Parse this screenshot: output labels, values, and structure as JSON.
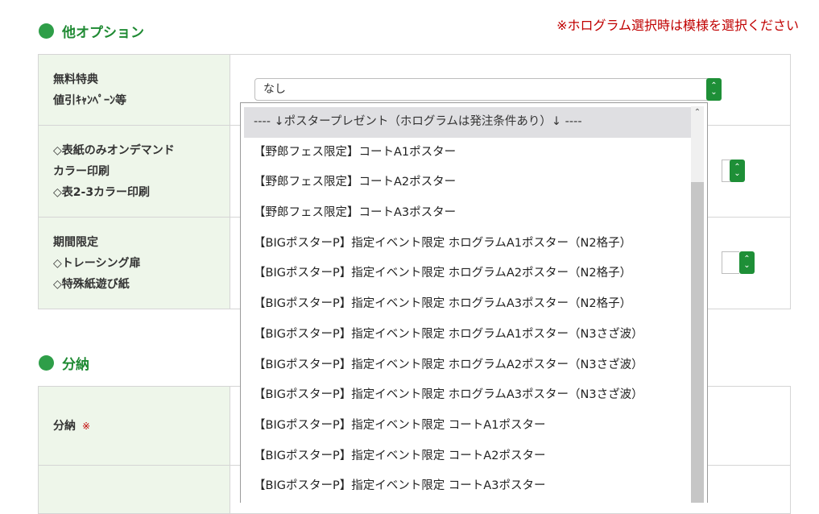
{
  "sections": {
    "other_options": {
      "title": "他オプション"
    },
    "bunno": {
      "title": "分納"
    }
  },
  "notice": "※ホログラム選択時は模様を選択ください",
  "rows": {
    "free_bonus": {
      "line1": "無料特典",
      "line2": "値引ｷｬﾝﾍﾟｰﾝ等"
    },
    "cover": {
      "line1": "◇表紙のみオンデマンド",
      "line2": "カラー印刷",
      "line3": "◇表2-3カラー印刷"
    },
    "limited": {
      "line1": "期間限定",
      "line2": "◇トレーシング扉",
      "line3": "◇特殊紙遊び紙"
    },
    "bunno": {
      "label": "分納",
      "required": "※"
    }
  },
  "select": {
    "value": "なし"
  },
  "dropdown": {
    "options": [
      "---- ↓ポスタープレゼント（ホログラムは発注条件あり）↓ ----",
      "【野郎フェス限定】コートA1ポスター",
      "【野郎フェス限定】コートA2ポスター",
      "【野郎フェス限定】コートA3ポスター",
      "【BIGポスターP】指定イベント限定 ホログラムA1ポスター（N2格子）",
      "【BIGポスターP】指定イベント限定 ホログラムA2ポスター（N2格子）",
      "【BIGポスターP】指定イベント限定 ホログラムA3ポスター（N2格子）",
      "【BIGポスターP】指定イベント限定 ホログラムA1ポスター（N3さざ波）",
      "【BIGポスターP】指定イベント限定 ホログラムA2ポスター（N3さざ波）",
      "【BIGポスターP】指定イベント限定 ホログラムA3ポスター（N3さざ波）",
      "【BIGポスターP】指定イベント限定 コートA1ポスター",
      "【BIGポスターP】指定イベント限定 コートA2ポスター",
      "【BIGポスターP】指定イベント限定 コートA3ポスター"
    ]
  },
  "colors": {
    "accent": "#2e9e48",
    "label_bg": "#eef6ea",
    "notice": "#c00000"
  }
}
